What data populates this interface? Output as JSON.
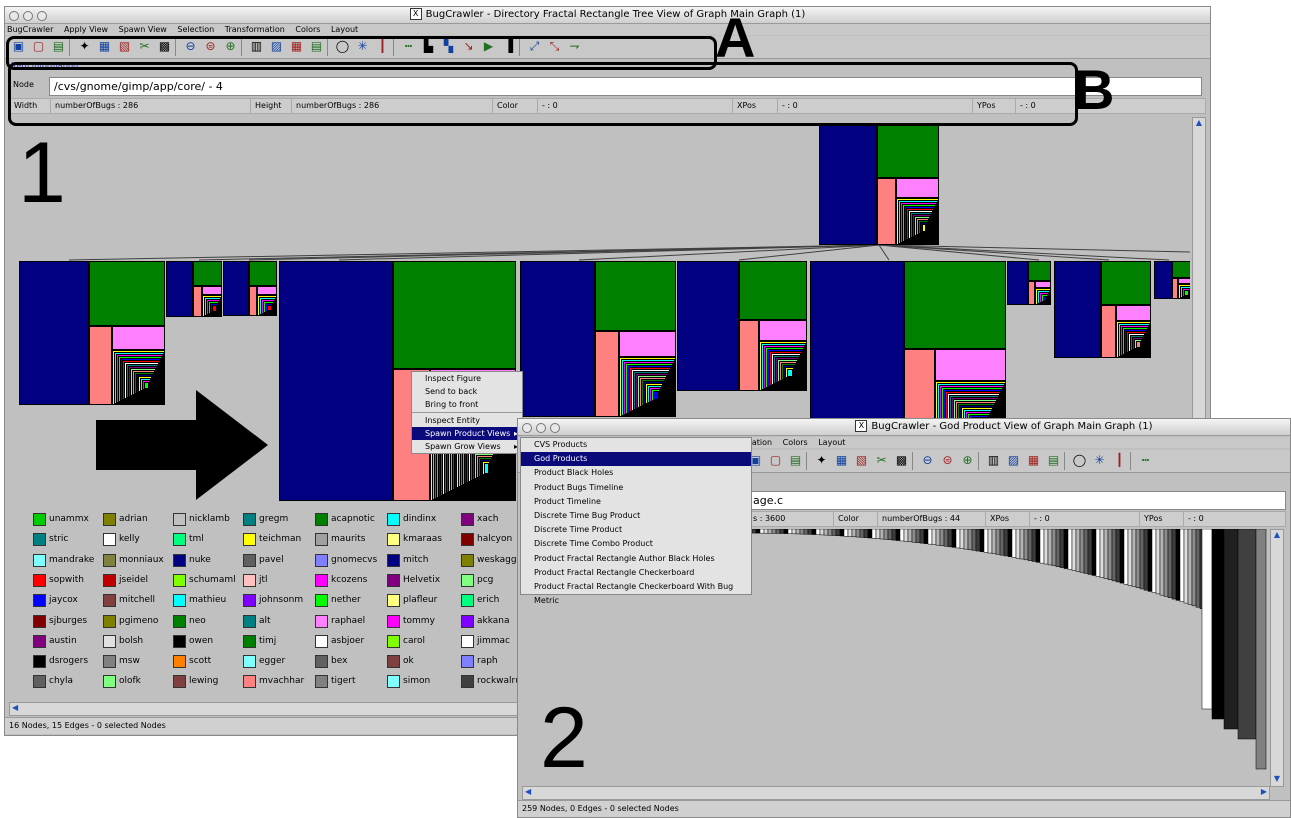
{
  "main_window": {
    "title": "BugCrawler - Directory Fractal Rectangle Tree View of Graph Main Graph (1)",
    "menu": [
      "BugCrawler",
      "Apply View",
      "Spawn View",
      "Selection",
      "Transformation",
      "Colors",
      "Layout"
    ],
    "item_info_label": "Item Information",
    "node_label": "Node",
    "node_value": "/cvs/gnome/gimp/app/core/ - 4",
    "width_label": "Width",
    "width_value": "numberOfBugs : 286",
    "height_label": "Height",
    "height_value": "numberOfBugs : 286",
    "color_label": "Color",
    "color_value": "- : 0",
    "xpos_label": "XPos",
    "xpos_value": "- : 0",
    "ypos_label": "YPos",
    "ypos_value": "- : 0",
    "status": "16 Nodes, 15 Edges - 0 selected Nodes",
    "legend": [
      {
        "name": "unammx",
        "color": "#00cc00"
      },
      {
        "name": "adrian",
        "color": "#808000"
      },
      {
        "name": "nicklamb",
        "color": "#c0c0c0"
      },
      {
        "name": "gregm",
        "color": "#008080"
      },
      {
        "name": "acapnotic",
        "color": "#008000"
      },
      {
        "name": "dindinx",
        "color": "#00ffff"
      },
      {
        "name": "xach",
        "color": "#800080"
      },
      {
        "name": "stric",
        "color": "#008080"
      },
      {
        "name": "kelly",
        "color": "#ffffff"
      },
      {
        "name": "tml",
        "color": "#00ff80"
      },
      {
        "name": "teichman",
        "color": "#ffff00"
      },
      {
        "name": "maurits",
        "color": "#a0a0a0"
      },
      {
        "name": "kmaraas",
        "color": "#ffff80"
      },
      {
        "name": "halcyon",
        "color": "#800000"
      },
      {
        "name": "mandrake",
        "color": "#80ffff"
      },
      {
        "name": "monniaux",
        "color": "#808040"
      },
      {
        "name": "nuke",
        "color": "#000080"
      },
      {
        "name": "pavel",
        "color": "#606060"
      },
      {
        "name": "gnomecvs",
        "color": "#8080ff"
      },
      {
        "name": "mitch",
        "color": "#000080"
      },
      {
        "name": "weskaggs",
        "color": "#808000"
      },
      {
        "name": "sopwith",
        "color": "#ff0000"
      },
      {
        "name": "jseidel",
        "color": "#c00000"
      },
      {
        "name": "schumaml",
        "color": "#80ff00"
      },
      {
        "name": "jtl",
        "color": "#ffc0c0"
      },
      {
        "name": "kcozens",
        "color": "#ff00ff"
      },
      {
        "name": "Helvetix",
        "color": "#800080"
      },
      {
        "name": "pcg",
        "color": "#80ff80"
      },
      {
        "name": "jaycox",
        "color": "#0000ff"
      },
      {
        "name": "mitchell",
        "color": "#804040"
      },
      {
        "name": "mathieu",
        "color": "#00ffff"
      },
      {
        "name": "johnsonm",
        "color": "#8000ff"
      },
      {
        "name": "nether",
        "color": "#00ff00"
      },
      {
        "name": "plafleur",
        "color": "#ffff80"
      },
      {
        "name": "erich",
        "color": "#00ff80"
      },
      {
        "name": "sjburges",
        "color": "#800000"
      },
      {
        "name": "pgimeno",
        "color": "#808000"
      },
      {
        "name": "neo",
        "color": "#008000"
      },
      {
        "name": "alt",
        "color": "#008080"
      },
      {
        "name": "raphael",
        "color": "#ff80ff"
      },
      {
        "name": "tommy",
        "color": "#ff00ff"
      },
      {
        "name": "akkana",
        "color": "#8000ff"
      },
      {
        "name": "austin",
        "color": "#800080"
      },
      {
        "name": "bolsh",
        "color": "#e0e0e0"
      },
      {
        "name": "owen",
        "color": "#000000"
      },
      {
        "name": "timj",
        "color": "#008000"
      },
      {
        "name": "asbjoer",
        "color": "#ffffff"
      },
      {
        "name": "carol",
        "color": "#80ff00"
      },
      {
        "name": "jimmac",
        "color": "#ffffff"
      },
      {
        "name": "dsrogers",
        "color": "#000000"
      },
      {
        "name": "msw",
        "color": "#808080"
      },
      {
        "name": "scott",
        "color": "#ff8000"
      },
      {
        "name": "egger",
        "color": "#80ffff"
      },
      {
        "name": "bex",
        "color": "#606060"
      },
      {
        "name": "ok",
        "color": "#804040"
      },
      {
        "name": "raph",
        "color": "#8080ff"
      },
      {
        "name": "chyla",
        "color": "#606060"
      },
      {
        "name": "olofk",
        "color": "#80ff80"
      },
      {
        "name": "lewing",
        "color": "#804040"
      },
      {
        "name": "mvachhar",
        "color": "#ff8080"
      },
      {
        "name": "tigert",
        "color": "#808080"
      },
      {
        "name": "simon",
        "color": "#80ffff"
      },
      {
        "name": "rockwalrus",
        "color": "#404040"
      }
    ]
  },
  "context_menu": {
    "items": [
      "Inspect Figure",
      "Send to back",
      "Bring to front",
      "Inspect Entity",
      "Spawn Product Views",
      "Spawn Grow Views"
    ]
  },
  "submenu": {
    "items": [
      "CVS Products",
      "God Products",
      "Product Black Holes",
      "Product Bugs Timeline",
      "Product Timeline",
      "Discrete Time Bug Product",
      "Discrete Time Product",
      "Discrete Time Combo Product",
      "Product Fractal Rectangle Author Black Holes",
      "Product Fractal Rectangle Checkerboard",
      "Product Fractal Rectangle Checkerboard With Bug Metric"
    ]
  },
  "second_window": {
    "title": "BugCrawler - God Product View of Graph Main Graph (1)",
    "menu_partial": "ormation",
    "menu": [
      "Colors",
      "Layout"
    ],
    "node_value_partial": "age.c",
    "width_value_partial": "s : 3600",
    "color_label": "Color",
    "color_value": "numberOfBugs : 44",
    "xpos_label": "XPos",
    "xpos_value": "- : 0",
    "ypos_label": "YPos",
    "ypos_value": "- : 0",
    "status": "259 Nodes, 0 Edges - 0 selected Nodes"
  },
  "annotations": {
    "a": "A",
    "b": "B",
    "one": "1",
    "two": "2"
  },
  "colors": {
    "navy": "#000080",
    "green": "#007f00",
    "pink": "#ff80ff",
    "salmon": "#ff8080",
    "canvas": "#c0c0c0",
    "menu_highlight": "#0a0a7a"
  }
}
